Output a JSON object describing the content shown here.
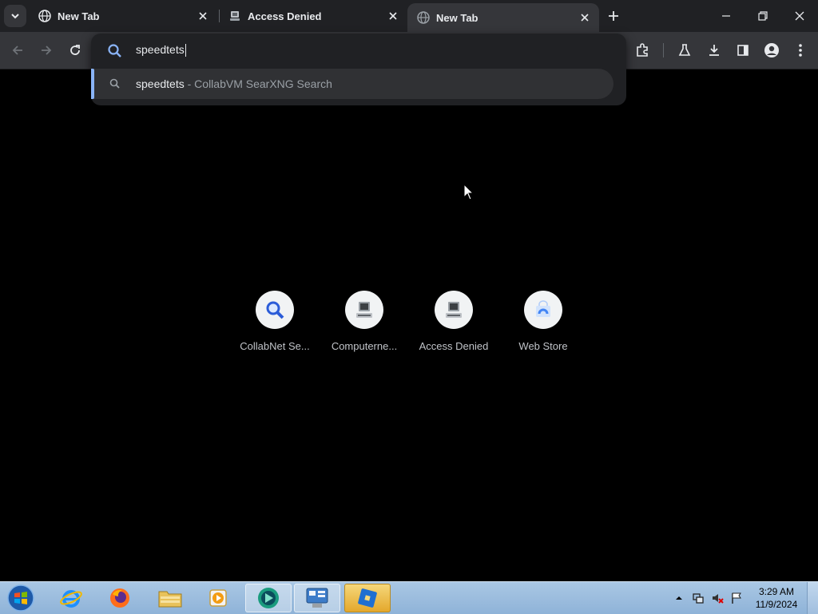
{
  "tabs": [
    {
      "title": "New Tab",
      "favicon": "globe-icon",
      "active": false
    },
    {
      "title": "Access Denied",
      "favicon": "computer-icon",
      "active": false
    },
    {
      "title": "New Tab",
      "favicon": "globe-icon",
      "active": true
    }
  ],
  "omnibox": {
    "input_value": "speedtets",
    "suggestion": {
      "query": "speedtets",
      "separator": " - ",
      "engine": "CollabVM SearXNG Search"
    }
  },
  "shortcuts": [
    {
      "label": "CollabNet Se...",
      "icon": "search-icon"
    },
    {
      "label": "Computerne...",
      "icon": "computer-icon"
    },
    {
      "label": "Access Denied",
      "icon": "computer-icon"
    },
    {
      "label": "Web Store",
      "icon": "webstore-icon"
    }
  ],
  "taskbar": {
    "apps": [
      "internet-explorer-icon",
      "firefox-icon",
      "file-explorer-icon",
      "media-player-icon",
      "app-icon",
      "control-panel-icon",
      "roblox-studio-icon"
    ],
    "clock_time": "3:29 AM",
    "clock_date": "11/9/2024"
  },
  "colors": {
    "tabstrip": "#202124",
    "toolbar": "#35363a",
    "accent": "#8ab4f8"
  }
}
